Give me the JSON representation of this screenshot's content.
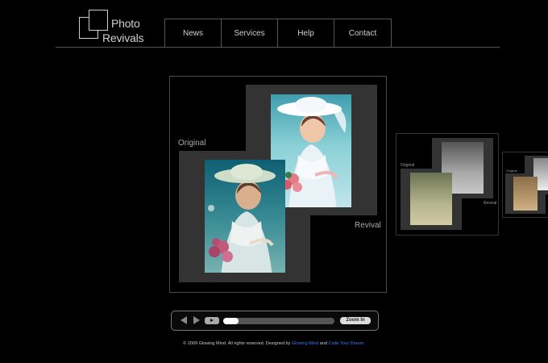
{
  "logo": {
    "line1": "Photo",
    "line2": "Revivals"
  },
  "nav": {
    "items": [
      "News",
      "Services",
      "Help",
      "Contact"
    ]
  },
  "main": {
    "label_original": "Original",
    "label_revival": "Revival"
  },
  "thumbnails": [
    {
      "label_original": "Original",
      "label_revival": "Revival"
    },
    {
      "label_original": "Original"
    }
  ],
  "controls": {
    "zoom_label": "Zoom In",
    "progress": 0.14
  },
  "footer": {
    "text": "© 2009 Glowing Mind. All rights reserved. Designed by",
    "link1": "Glowing Mind",
    "and": "and",
    "link2": "Code Your Dream."
  },
  "colors": {
    "background": "#000000",
    "link": "#3c78ff"
  }
}
